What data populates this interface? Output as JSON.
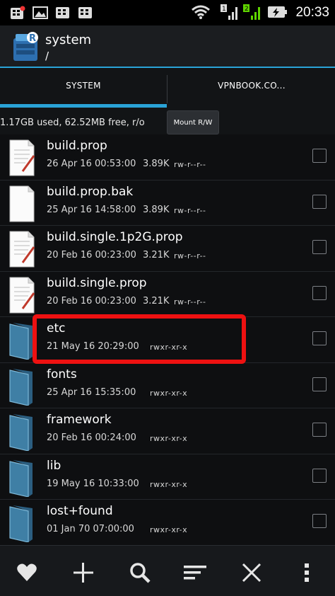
{
  "status_bar": {
    "time": "20:33",
    "icons": [
      "bbm-notification-icon",
      "gallery-icon",
      "bbm-icon",
      "bbm-icon",
      "wifi-icon",
      "sim1-signal-icon",
      "sim2-signal-icon",
      "battery-charging-icon"
    ]
  },
  "app_bar": {
    "title": "system",
    "path": "/",
    "icon": "root-explorer-icon"
  },
  "tabs": [
    {
      "label": "SYSTEM",
      "active": true
    },
    {
      "label": "VPNBOOK.CO...",
      "active": false
    }
  ],
  "info": {
    "storage": "1.17GB used, 62.52MB free, r/o",
    "mount_button": "Mount R/W"
  },
  "files": [
    {
      "name": "build.prop",
      "date": "26 Apr 16 00:53:00",
      "size": "3.89K",
      "perms": "rw-r--r--",
      "type": "file-edit"
    },
    {
      "name": "build.prop.bak",
      "date": "25 Apr 16 14:58:00",
      "size": "3.89K",
      "perms": "rw-r--r--",
      "type": "file"
    },
    {
      "name": "build.single.1p2G.prop",
      "date": "20 Feb 16 00:23:00",
      "size": "3.21K",
      "perms": "rw-r--r--",
      "type": "file-edit"
    },
    {
      "name": "build.single.prop",
      "date": "20 Feb 16 00:23:00",
      "size": "3.21K",
      "perms": "rw-r--r--",
      "type": "file-edit"
    },
    {
      "name": "etc",
      "date": "21 May 16 20:29:00",
      "size": "",
      "perms": "rwxr-xr-x",
      "type": "folder"
    },
    {
      "name": "fonts",
      "date": "25 Apr 16 15:35:00",
      "size": "",
      "perms": "rwxr-xr-x",
      "type": "folder"
    },
    {
      "name": "framework",
      "date": "20 Feb 16 00:24:00",
      "size": "",
      "perms": "rwxr-xr-x",
      "type": "folder"
    },
    {
      "name": "lib",
      "date": "19 May 16 10:33:00",
      "size": "",
      "perms": "rwxr-xr-x",
      "type": "folder"
    },
    {
      "name": "lost+found",
      "date": "01 Jan 70 07:00:00",
      "size": "",
      "perms": "rwxr-xr-x",
      "type": "folder"
    }
  ],
  "bottom_bar": [
    "heart-icon",
    "add-icon",
    "search-icon",
    "sort-icon",
    "close-icon",
    "overflow-menu-icon"
  ],
  "colors": {
    "accent": "#2aa3d7",
    "highlight": "#ee1111",
    "background": "#0e0f11"
  }
}
